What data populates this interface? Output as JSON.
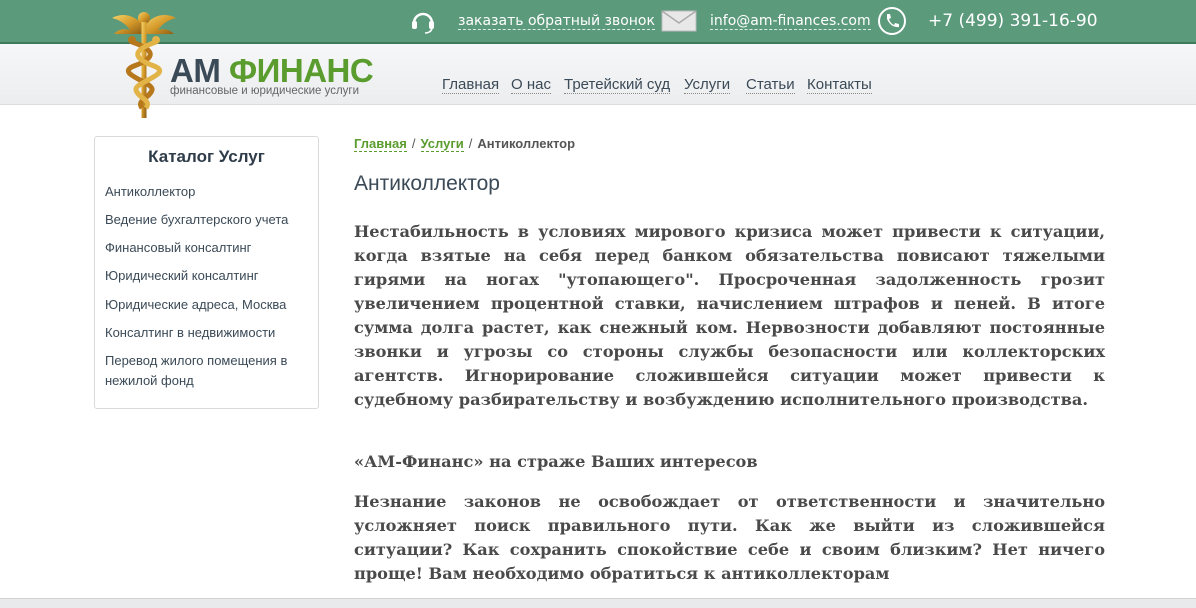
{
  "topbar": {
    "callback_label": "заказать обратный звонок",
    "email": "info@am-finances.com",
    "phone": "+7 (499) 391-16-90",
    "icons": {
      "callback": "headset-icon",
      "email": "envelope-icon",
      "phone": "phone-icon"
    }
  },
  "logo": {
    "am": "АМ",
    "finance": "ФИНАНС",
    "subtitle": "финансовые и юридические услуги"
  },
  "nav": [
    "Главная",
    "О нас",
    "Третейский суд",
    "Услуги",
    "Статьи",
    "Контакты"
  ],
  "sidebar": {
    "title": "Каталог Услуг",
    "items": [
      "Антиколлектор",
      "Ведение бухгалтерского учета",
      "Финансовый консалтинг",
      "Юридический консалтинг",
      "Юридические адреса, Москва",
      "Консалтинг в недвижимости",
      "Перевод жилого помещения в нежилой фонд"
    ]
  },
  "breadcrumb": [
    "Главная",
    "Услуги",
    "Антиколлектор"
  ],
  "title": "Антиколлектор",
  "paragraph1": "Нестабильность в условиях мирового кризиса может привести к ситуации, когда взятые на себя перед банком обязательства повисают тяжелыми гирями на ногах \"утопающего\". Просроченная задолженность грозит увеличением процентной ставки, начислением штрафов и пеней. В итоге сумма долга растет, как снежный ком. Нервозности добавляют постоянные звонки и угрозы со стороны службы безопасности или коллекторских агентств. Игнорирование сложившейся ситуации может привести к судебному разбирательству и возбуждению исполнительного производства.",
  "subheading": "«АМ-Финанс» на страже Ваших интересов",
  "paragraph2": "Незнание законов не освобождает от ответственности и значительно усложняет поиск правильного пути. Как же выйти из сложившейся ситуации? Как сохранить спокойствие себе и своим близким? Нет ничего проще! Вам необходимо обратиться к антиколлекторам",
  "colors": {
    "topbar": "#5c9a7c",
    "accent": "#5a9c2d",
    "text": "#3b4a57"
  }
}
